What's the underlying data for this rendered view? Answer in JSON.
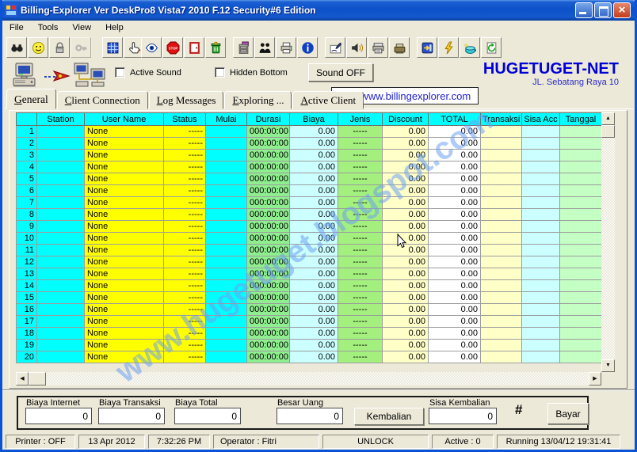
{
  "window": {
    "title": "Billing-Explorer Ver DeskPro8 Vista7 2010 F.12 Security#6 Edition"
  },
  "menu": [
    "File",
    "Tools",
    "View",
    "Help"
  ],
  "toolbar_groups": [
    [
      "find",
      "smiley",
      "lock",
      "key"
    ],
    [
      "clients-grid",
      "hand-pen"
    ],
    [
      "eye",
      "stop",
      "door",
      "trash"
    ],
    [
      "cabinet",
      "users",
      "printer",
      "info"
    ],
    [
      "signature",
      "speaker",
      "print-doc",
      "print-unit"
    ],
    [
      "export",
      "lightning",
      "pot",
      "refresh"
    ]
  ],
  "header": {
    "active_sound": "Active Sound",
    "hidden_bottom": "Hidden Bottom",
    "sound_button": "Sound OFF",
    "brand": "HUGETUGET-NET",
    "address": "JL. Sebatang Raya 10",
    "url": "http://www.billingexplorer.com"
  },
  "tabs": [
    "General",
    "Client Connection",
    "Log Messages",
    "Exploring ...",
    "Active Client"
  ],
  "table": {
    "headers": [
      "",
      "Station",
      "User Name",
      "Status",
      "Mulai",
      "Durasi",
      "Biaya",
      "Jenis",
      "Discount",
      "TOTAL",
      "Transaksi",
      "Sisa Acc",
      "Tanggal"
    ],
    "rows": [
      {
        "num": "1",
        "station": "",
        "user": "None",
        "status": "-----",
        "mulai": "",
        "durasi": "000:00:00",
        "biaya": "0.00",
        "jenis": "-----",
        "discount": "0.00",
        "total": "0.00",
        "transaksi": "",
        "sisa": "",
        "tanggal": ""
      },
      {
        "num": "2",
        "station": "",
        "user": "None",
        "status": "-----",
        "mulai": "",
        "durasi": "000:00:00",
        "biaya": "0.00",
        "jenis": "-----",
        "discount": "0.00",
        "total": "0.00",
        "transaksi": "",
        "sisa": "",
        "tanggal": ""
      },
      {
        "num": "3",
        "station": "",
        "user": "None",
        "status": "-----",
        "mulai": "",
        "durasi": "000:00:00",
        "biaya": "0.00",
        "jenis": "-----",
        "discount": "0.00",
        "total": "0.00",
        "transaksi": "",
        "sisa": "",
        "tanggal": ""
      },
      {
        "num": "4",
        "station": "",
        "user": "None",
        "status": "-----",
        "mulai": "",
        "durasi": "000:00:00",
        "biaya": "0.00",
        "jenis": "-----",
        "discount": "0.00",
        "total": "0.00",
        "transaksi": "",
        "sisa": "",
        "tanggal": ""
      },
      {
        "num": "5",
        "station": "",
        "user": "None",
        "status": "-----",
        "mulai": "",
        "durasi": "000:00:00",
        "biaya": "0.00",
        "jenis": "-----",
        "discount": "0.00",
        "total": "0.00",
        "transaksi": "",
        "sisa": "",
        "tanggal": ""
      },
      {
        "num": "6",
        "station": "",
        "user": "None",
        "status": "-----",
        "mulai": "",
        "durasi": "000:00:00",
        "biaya": "0.00",
        "jenis": "-----",
        "discount": "0.00",
        "total": "0.00",
        "transaksi": "",
        "sisa": "",
        "tanggal": ""
      },
      {
        "num": "7",
        "station": "",
        "user": "None",
        "status": "-----",
        "mulai": "",
        "durasi": "000:00:00",
        "biaya": "0.00",
        "jenis": "-----",
        "discount": "0.00",
        "total": "0.00",
        "transaksi": "",
        "sisa": "",
        "tanggal": ""
      },
      {
        "num": "8",
        "station": "",
        "user": "None",
        "status": "-----",
        "mulai": "",
        "durasi": "000:00:00",
        "biaya": "0.00",
        "jenis": "-----",
        "discount": "0.00",
        "total": "0.00",
        "transaksi": "",
        "sisa": "",
        "tanggal": ""
      },
      {
        "num": "9",
        "station": "",
        "user": "None",
        "status": "-----",
        "mulai": "",
        "durasi": "000:00:00",
        "biaya": "0.00",
        "jenis": "-----",
        "discount": "0.00",
        "total": "0.00",
        "transaksi": "",
        "sisa": "",
        "tanggal": ""
      },
      {
        "num": "10",
        "station": "",
        "user": "None",
        "status": "-----",
        "mulai": "",
        "durasi": "000:00:00",
        "biaya": "0.00",
        "jenis": "-----",
        "discount": "0.00",
        "total": "0.00",
        "transaksi": "",
        "sisa": "",
        "tanggal": ""
      },
      {
        "num": "11",
        "station": "",
        "user": "None",
        "status": "-----",
        "mulai": "",
        "durasi": "000:00:00",
        "biaya": "0.00",
        "jenis": "-----",
        "discount": "0.00",
        "total": "0.00",
        "transaksi": "",
        "sisa": "",
        "tanggal": ""
      },
      {
        "num": "12",
        "station": "",
        "user": "None",
        "status": "-----",
        "mulai": "",
        "durasi": "000:00:00",
        "biaya": "0.00",
        "jenis": "-----",
        "discount": "0.00",
        "total": "0.00",
        "transaksi": "",
        "sisa": "",
        "tanggal": ""
      },
      {
        "num": "13",
        "station": "",
        "user": "None",
        "status": "-----",
        "mulai": "",
        "durasi": "000:00:00",
        "biaya": "0.00",
        "jenis": "-----",
        "discount": "0.00",
        "total": "0.00",
        "transaksi": "",
        "sisa": "",
        "tanggal": ""
      },
      {
        "num": "14",
        "station": "",
        "user": "None",
        "status": "-----",
        "mulai": "",
        "durasi": "000:00:00",
        "biaya": "0.00",
        "jenis": "-----",
        "discount": "0.00",
        "total": "0.00",
        "transaksi": "",
        "sisa": "",
        "tanggal": ""
      },
      {
        "num": "15",
        "station": "",
        "user": "None",
        "status": "-----",
        "mulai": "",
        "durasi": "000:00:00",
        "biaya": "0.00",
        "jenis": "-----",
        "discount": "0.00",
        "total": "0.00",
        "transaksi": "",
        "sisa": "",
        "tanggal": ""
      },
      {
        "num": "16",
        "station": "",
        "user": "None",
        "status": "-----",
        "mulai": "",
        "durasi": "000:00:00",
        "biaya": "0.00",
        "jenis": "-----",
        "discount": "0.00",
        "total": "0.00",
        "transaksi": "",
        "sisa": "",
        "tanggal": ""
      },
      {
        "num": "17",
        "station": "",
        "user": "None",
        "status": "-----",
        "mulai": "",
        "durasi": "000:00:00",
        "biaya": "0.00",
        "jenis": "-----",
        "discount": "0.00",
        "total": "0.00",
        "transaksi": "",
        "sisa": "",
        "tanggal": ""
      },
      {
        "num": "18",
        "station": "",
        "user": "None",
        "status": "-----",
        "mulai": "",
        "durasi": "000:00:00",
        "biaya": "0.00",
        "jenis": "-----",
        "discount": "0.00",
        "total": "0.00",
        "transaksi": "",
        "sisa": "",
        "tanggal": ""
      },
      {
        "num": "19",
        "station": "",
        "user": "None",
        "status": "-----",
        "mulai": "",
        "durasi": "000:00:00",
        "biaya": "0.00",
        "jenis": "-----",
        "discount": "0.00",
        "total": "0.00",
        "transaksi": "",
        "sisa": "",
        "tanggal": ""
      },
      {
        "num": "20",
        "station": "",
        "user": "None",
        "status": "-----",
        "mulai": "",
        "durasi": "000:00:00",
        "biaya": "0.00",
        "jenis": "-----",
        "discount": "0.00",
        "total": "0.00",
        "transaksi": "",
        "sisa": "",
        "tanggal": ""
      }
    ]
  },
  "watermark": "www.hugetuget.blogspot.com",
  "payment": {
    "fields": [
      {
        "label": "Biaya Internet",
        "value": "0"
      },
      {
        "label": "Biaya Transaksi",
        "value": "0"
      },
      {
        "label": "Biaya Total",
        "value": "0"
      },
      {
        "label": "Besar Uang",
        "value": "0"
      }
    ],
    "kembalian": "Kembalian",
    "sisa_label": "Sisa Kembalian",
    "sisa_value": "0",
    "hash": "#",
    "bayar": "Bayar"
  },
  "statusbar": {
    "printer": "Printer : OFF",
    "date": "13 Apr 2012",
    "time": "7:32:26 PM",
    "operator": "Operator : Fitri",
    "lock": "UNLOCK",
    "active": "Active : 0",
    "running": "Running 13/04/12 19:31:41"
  }
}
